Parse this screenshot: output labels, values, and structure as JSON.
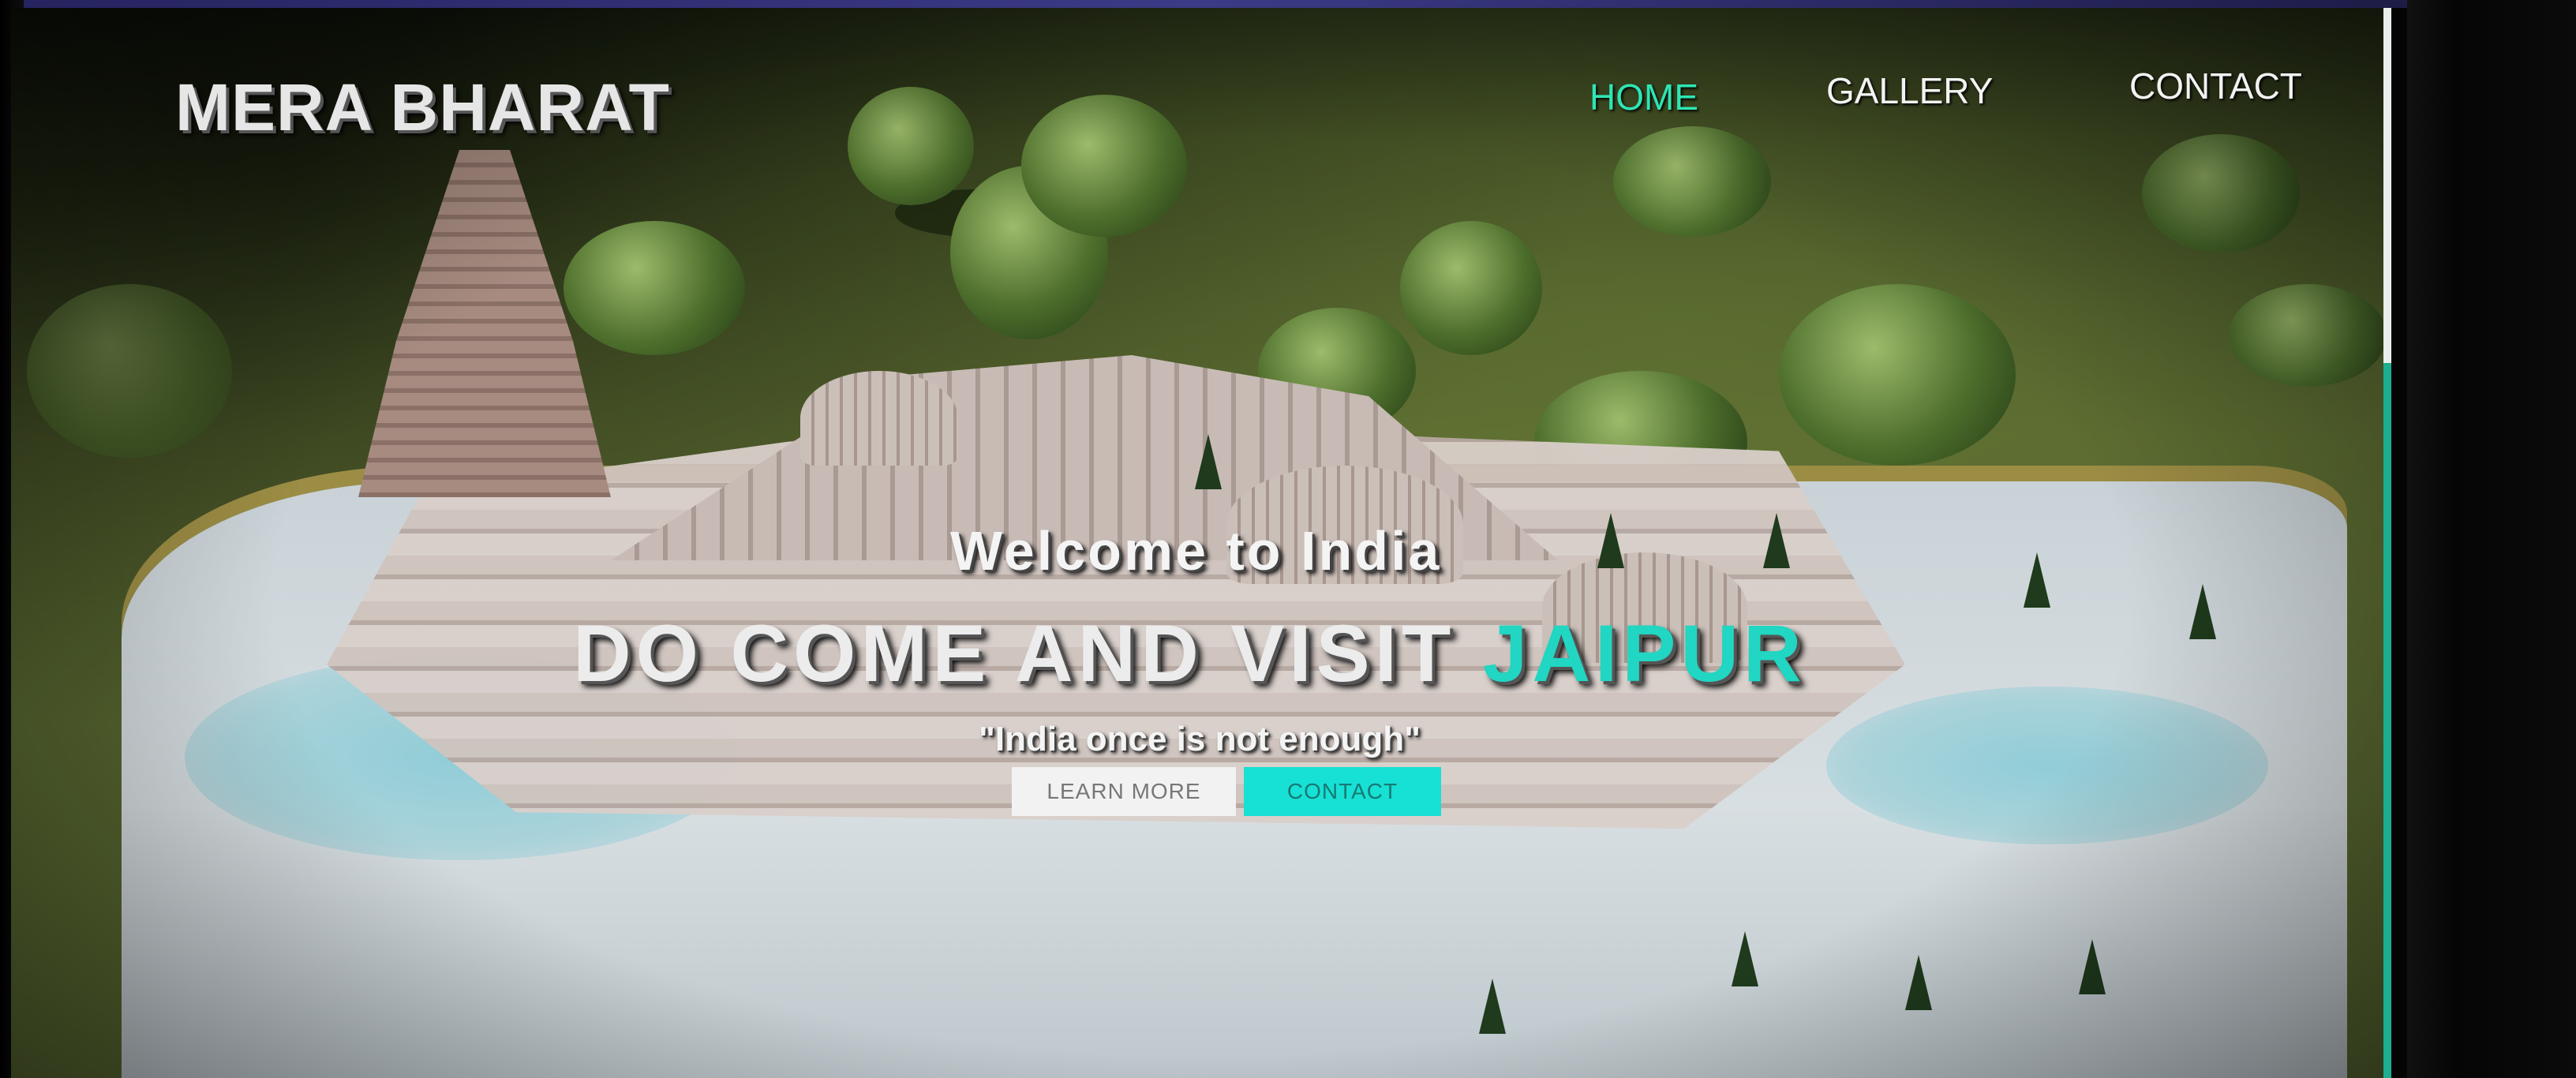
{
  "site": {
    "logo": "MERA BHARAT"
  },
  "nav": {
    "items": [
      {
        "label": "HOME",
        "active": true
      },
      {
        "label": "GALLERY",
        "active": false
      },
      {
        "label": "CONTACT",
        "active": false
      }
    ]
  },
  "hero": {
    "subtitle": "Welcome to India",
    "headline_main": "DO COME AND VISIT",
    "headline_accent": "JAIPUR",
    "tagline": "\"India once is not enough\"",
    "buttons": {
      "learn_more": "LEARN MORE",
      "contact": "CONTACT"
    }
  },
  "colors": {
    "accent": "#21d6c2",
    "nav_active": "#2ee6b4",
    "contact_button": "#17e0d4",
    "scrollbar_thumb": "#1cae8e"
  }
}
